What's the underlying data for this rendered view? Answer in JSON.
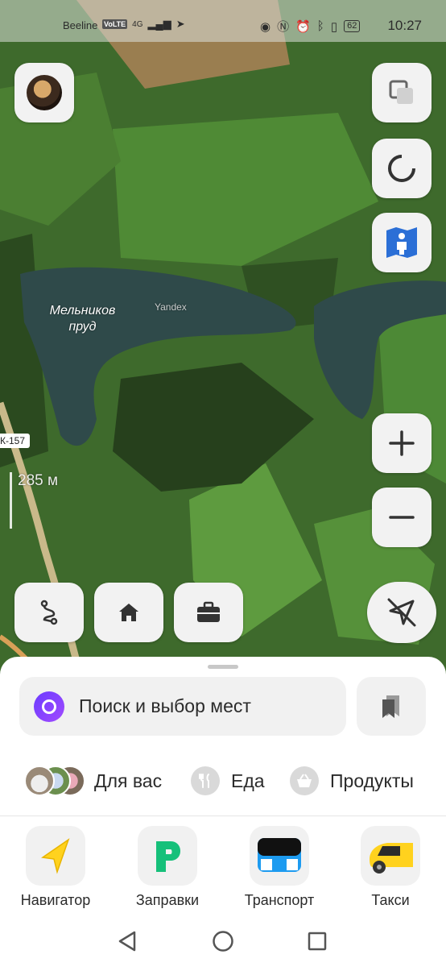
{
  "status_bar": {
    "carrier": "Beeline",
    "volte": "VoLTE",
    "network": "4G",
    "battery": "62",
    "time": "10:27"
  },
  "map": {
    "lake_label": "Мельников пруд",
    "watermark": "Yandex",
    "road_badge": "К-157",
    "scale": "285 м"
  },
  "search": {
    "placeholder": "Поиск и выбор мест"
  },
  "chips": [
    {
      "label": "Для вас"
    },
    {
      "label": "Еда",
      "icon": "fork-knife-icon"
    },
    {
      "label": "Продукты",
      "icon": "basket-icon"
    }
  ],
  "services": [
    {
      "label": "Навигатор",
      "icon": "navigator-arrow-icon"
    },
    {
      "label": "Заправки",
      "icon": "fuel-p-icon"
    },
    {
      "label": "Транспорт",
      "icon": "bus-icon"
    },
    {
      "label": "Такси",
      "icon": "taxi-car-icon"
    }
  ],
  "colors": {
    "accent_purple": "#7a3cff",
    "navigator_yellow": "#ffd21e",
    "fuel_green": "#16c07a",
    "bus_blue": "#1d9bf0",
    "taxi_yellow": "#ffd21e"
  }
}
